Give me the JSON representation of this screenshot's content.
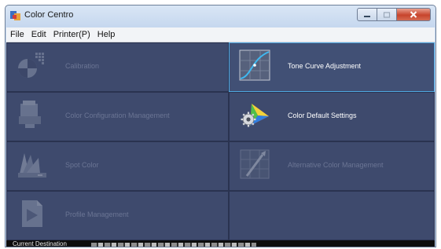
{
  "window": {
    "title": "Color Centro"
  },
  "menu": [
    {
      "label": "File"
    },
    {
      "label": "Edit"
    },
    {
      "label": "Printer(P)"
    },
    {
      "label": "Help"
    }
  ],
  "tiles": [
    {
      "label": "Calibration",
      "icon": "calibration-icon",
      "enabled": false
    },
    {
      "label": "Tone Curve Adjustment",
      "icon": "tone-curve-icon",
      "enabled": true,
      "selected": true
    },
    {
      "label": "Color Configuration Management",
      "icon": "color-configuration-icon",
      "enabled": false
    },
    {
      "label": "Color Default Settings",
      "icon": "color-default-settings-icon",
      "enabled": true
    },
    {
      "label": "Spot Color",
      "icon": "spot-color-icon",
      "enabled": false
    },
    {
      "label": "Alternative Color Management",
      "icon": "alternative-color-icon",
      "enabled": false
    },
    {
      "label": "Profile Management",
      "icon": "profile-management-icon",
      "enabled": false
    }
  ],
  "status": {
    "label": "Current Destination"
  },
  "colors": {
    "panel": "#3e4a6d",
    "selected_border": "#4fa9e2",
    "disabled_text": "#6b7594",
    "enabled_text": "#ffffff",
    "status_bar": "#0d0d0d"
  }
}
